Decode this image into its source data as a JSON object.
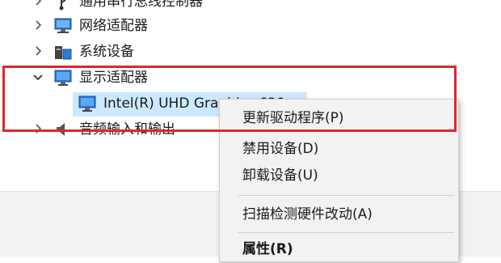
{
  "tree": {
    "items": [
      {
        "label": "通用串行总线控制器",
        "icon": "usb-icon",
        "expanded": false
      },
      {
        "label": "网络适配器",
        "icon": "network-adapter-icon",
        "expanded": false
      },
      {
        "label": "系统设备",
        "icon": "system-device-icon",
        "expanded": false
      },
      {
        "label": "显示适配器",
        "icon": "display-adapter-icon",
        "expanded": true
      },
      {
        "label": "Intel(R) UHD Graphics 630",
        "icon": "monitor-icon",
        "selected": true
      },
      {
        "label": "音频输入和输出",
        "icon": "speaker-icon",
        "expanded": false
      }
    ]
  },
  "context_menu": {
    "items": [
      {
        "label": "更新驱动程序(P)",
        "bold": false
      },
      {
        "label": "禁用设备(D)",
        "bold": false
      },
      {
        "label": "卸载设备(U)",
        "bold": false
      },
      {
        "label": "扫描检测硬件改动(A)",
        "bold": false
      },
      {
        "label": "属性(R)",
        "bold": true
      }
    ]
  },
  "colors": {
    "highlight_box": "#e0262e",
    "selection": "#cce8ff",
    "menu_background": "#f2f2f2"
  }
}
